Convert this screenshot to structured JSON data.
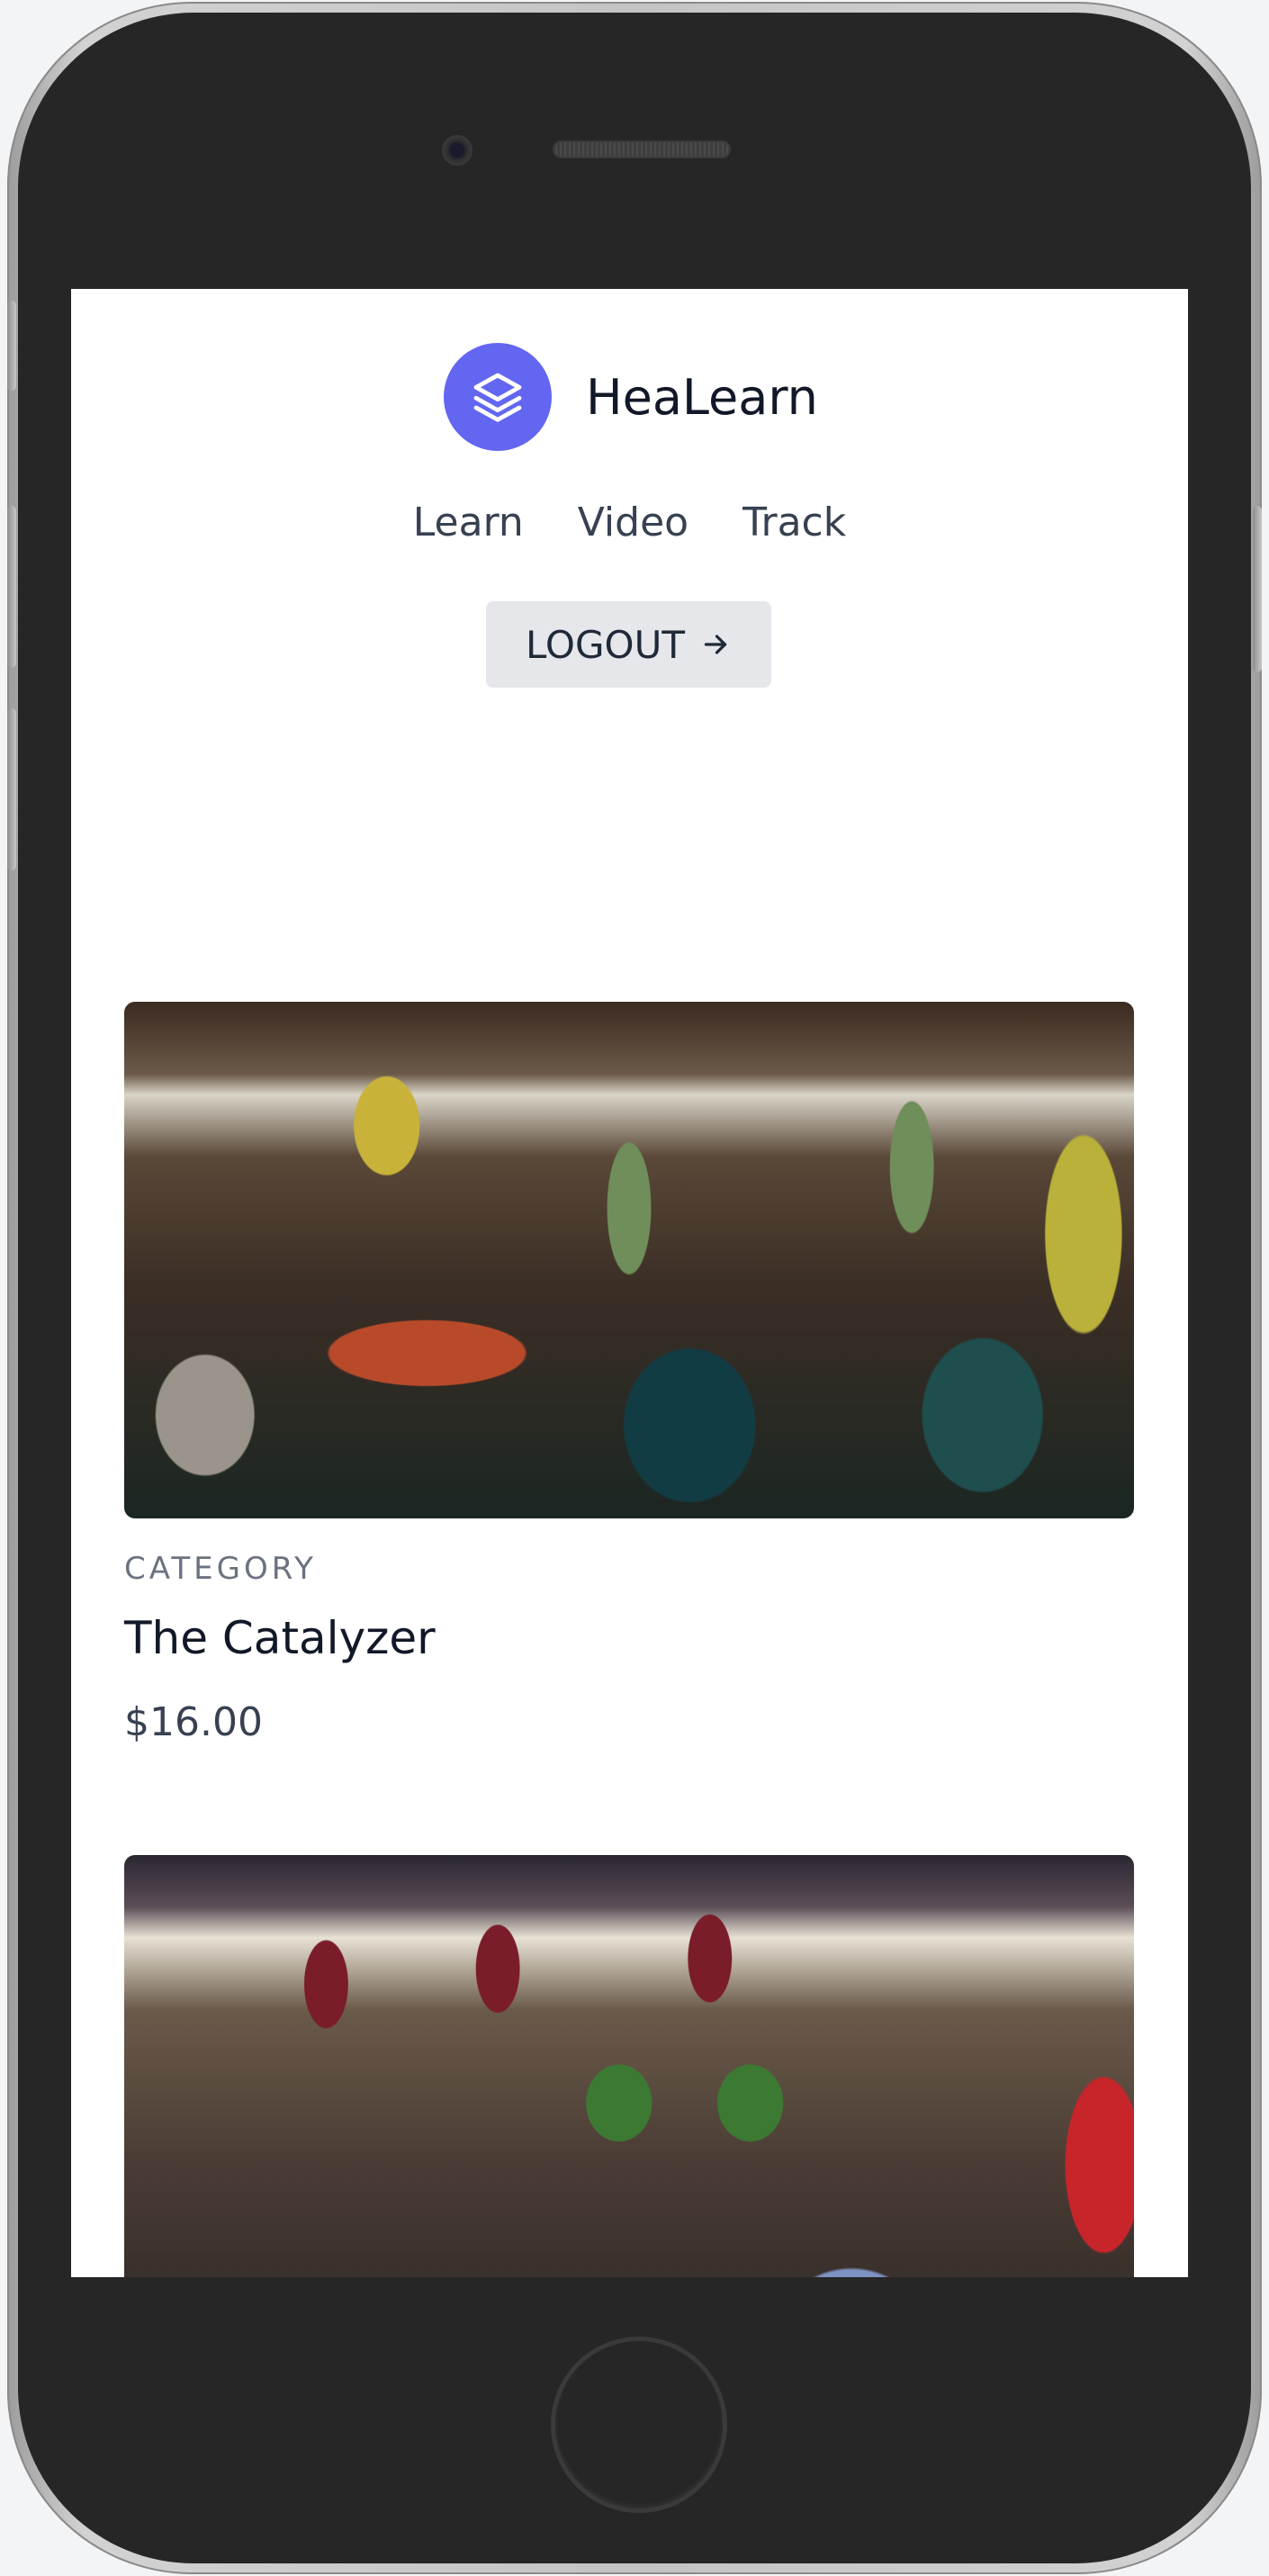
{
  "app": {
    "name": "HeaLearn",
    "logo_icon": "stack-layers-icon",
    "accent_color": "#6366f1"
  },
  "nav": {
    "items": [
      {
        "label": "Learn"
      },
      {
        "label": "Video"
      },
      {
        "label": "Track"
      }
    ]
  },
  "logout": {
    "label": "LOGOUT",
    "icon": "arrow-right-icon"
  },
  "products": [
    {
      "category": "CATEGORY",
      "title": "The Catalyzer",
      "price": "$16.00",
      "image": "market-stall-photo"
    },
    {
      "image": "market-produce-photo"
    }
  ]
}
